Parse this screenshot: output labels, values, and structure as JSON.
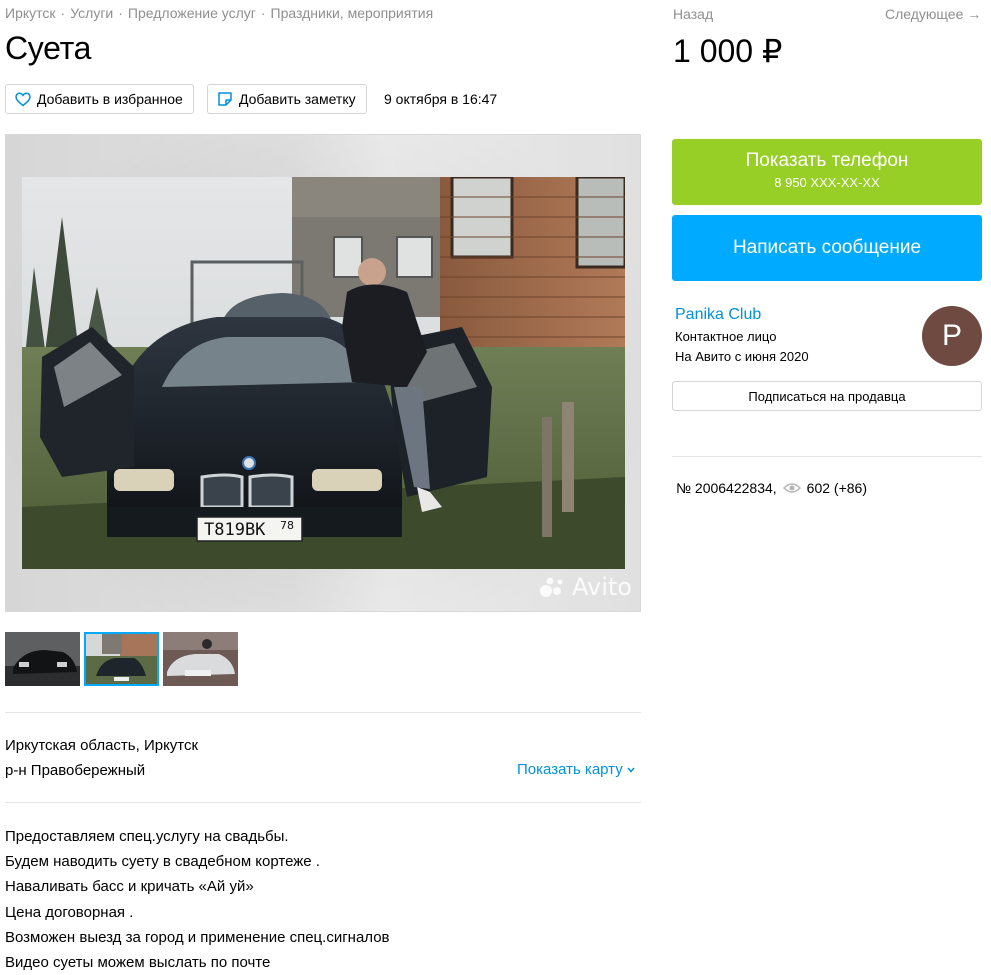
{
  "breadcrumbs": [
    "Иркутск",
    "Услуги",
    "Предложение услуг",
    "Праздники, мероприятия"
  ],
  "breadcrumb_separator": "·",
  "title": "Суета",
  "actions": {
    "favorite_label": "Добавить в избранное",
    "note_label": "Добавить заметку",
    "date": "9 октября в 16:47"
  },
  "gallery": {
    "watermark": "Avito",
    "plate_text": "Т819ВК",
    "plate_region": "78",
    "thumbnails": [
      {
        "name": "thumb-1",
        "active": false
      },
      {
        "name": "thumb-2",
        "active": true
      },
      {
        "name": "thumb-3",
        "active": false
      }
    ]
  },
  "location": {
    "region": "Иркутская область, Иркутск",
    "district": "р-н Правобережный",
    "map_link": "Показать карту"
  },
  "description": [
    "Предоставляем спец.услугу на свадьбы.",
    "Будем наводить суету в свадебном кортеже .",
    "Навaливать басс и кричать «Ай уй»",
    "Цена договорная .",
    "Возможен выезд за город и применение спец.сигналов",
    "Видео суеты можем выслать по почте"
  ],
  "nav": {
    "back": "Назад",
    "next": "Следующее →"
  },
  "price": "1 000 ₽",
  "contact": {
    "show_phone_label": "Показать телефон",
    "phone_masked": "8 950 XXX-XX-XX",
    "message_label": "Написать сообщение"
  },
  "seller": {
    "name": "Panika Club",
    "role": "Контактное лицо",
    "since": "На Авито с июня 2020",
    "avatar_letter": "P",
    "subscribe_label": "Подписаться на продавца"
  },
  "listing_meta": {
    "number": "№ 2006422834,",
    "views": "602 (+86)"
  },
  "colors": {
    "accent_green": "#97cf26",
    "accent_blue": "#00aaff",
    "link_blue": "#0091d9",
    "avatar_bg": "#6e4a41"
  }
}
